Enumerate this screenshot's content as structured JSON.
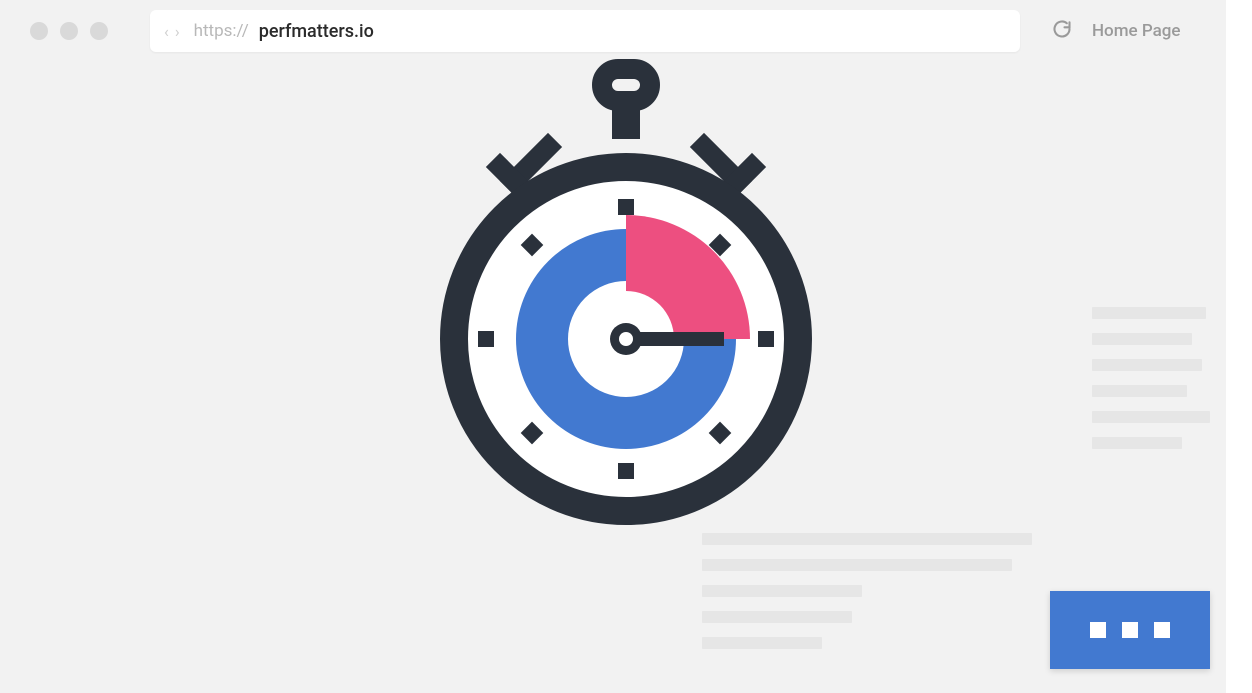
{
  "browser": {
    "protocol": "https://",
    "url": "perfmatters.io",
    "home_label": "Home Page"
  },
  "colors": {
    "accent_blue": "#4279d0",
    "accent_pink": "#ed4f80",
    "dark": "#2a313b"
  }
}
